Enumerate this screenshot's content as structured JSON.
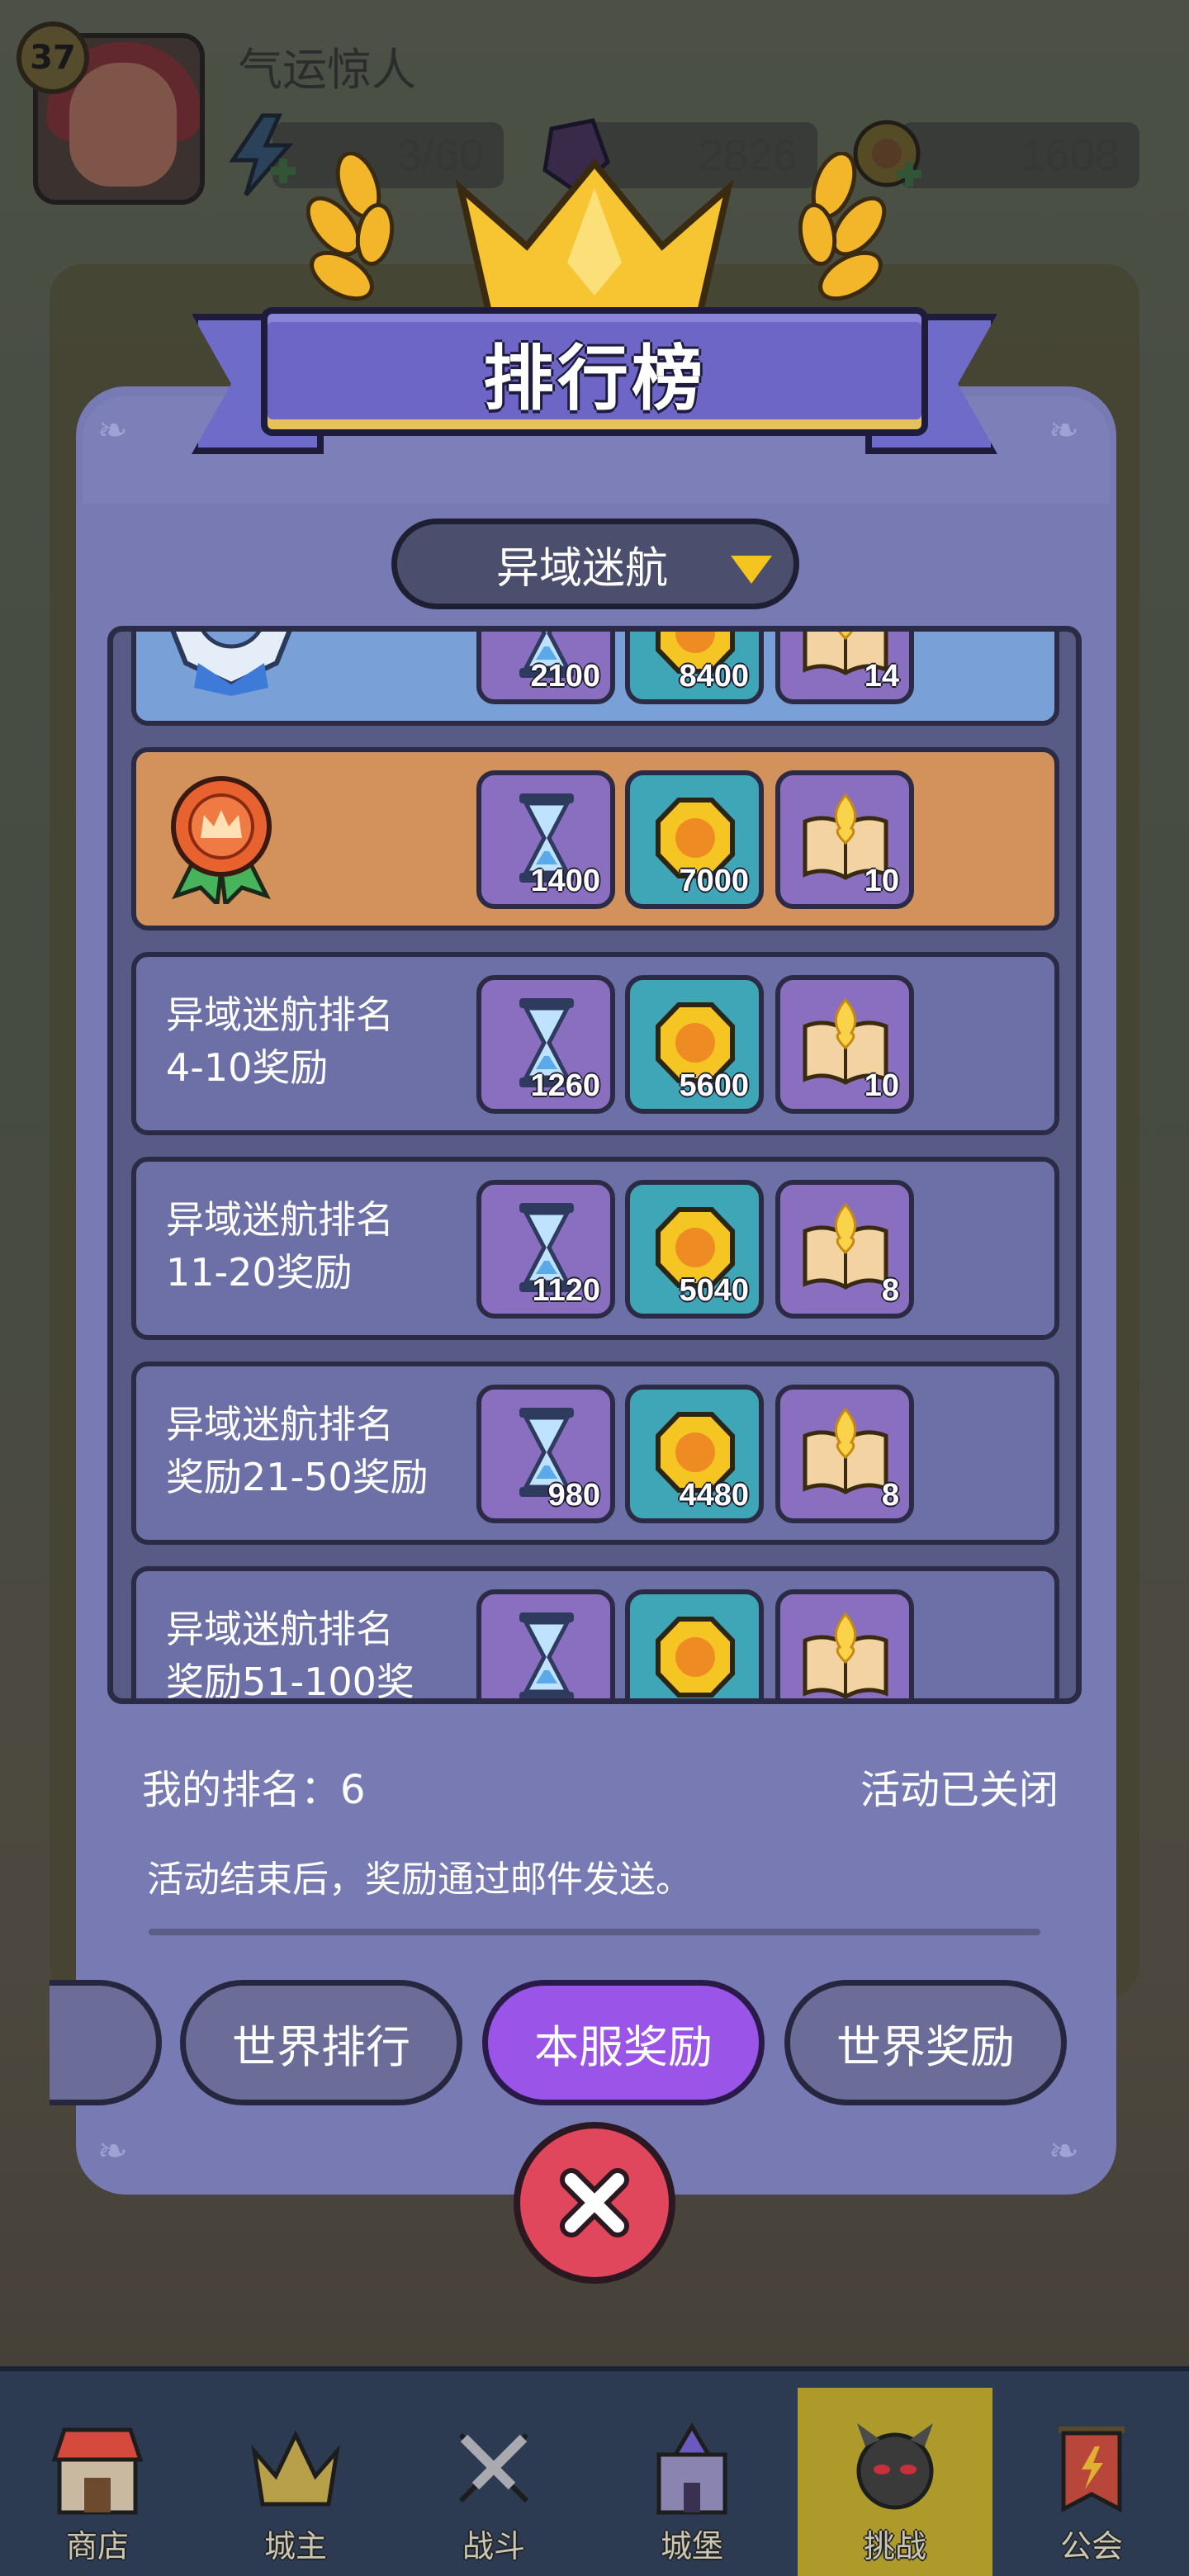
{
  "hud": {
    "level": "37",
    "player_name": "气运惊人",
    "energy": "3/60",
    "gems": "2826",
    "coins": "1608"
  },
  "modal": {
    "title": "排行榜",
    "dropdown_value": "异域迷航",
    "rows": [
      {
        "label": "",
        "tier": "silver",
        "items": [
          {
            "icon": "hourglass-icon",
            "qty": "2100"
          },
          {
            "icon": "gold-coin-icon",
            "qty": "8400"
          },
          {
            "icon": "spellbook-icon",
            "qty": "14"
          }
        ]
      },
      {
        "label": "",
        "tier": "bronze",
        "items": [
          {
            "icon": "hourglass-icon",
            "qty": "1400"
          },
          {
            "icon": "gold-coin-icon",
            "qty": "7000"
          },
          {
            "icon": "spellbook-icon",
            "qty": "10"
          }
        ]
      },
      {
        "label": "异域迷航排名\n4-10奖励",
        "tier": "normal",
        "items": [
          {
            "icon": "hourglass-icon",
            "qty": "1260"
          },
          {
            "icon": "gold-coin-icon",
            "qty": "5600"
          },
          {
            "icon": "spellbook-icon",
            "qty": "10"
          }
        ]
      },
      {
        "label": "异域迷航排名\n11-20奖励",
        "tier": "normal",
        "items": [
          {
            "icon": "hourglass-icon",
            "qty": "1120"
          },
          {
            "icon": "gold-coin-icon",
            "qty": "5040"
          },
          {
            "icon": "spellbook-icon",
            "qty": "8"
          }
        ]
      },
      {
        "label": "异域迷航排名\n奖励21-50奖励",
        "tier": "normal",
        "items": [
          {
            "icon": "hourglass-icon",
            "qty": "980"
          },
          {
            "icon": "gold-coin-icon",
            "qty": "4480"
          },
          {
            "icon": "spellbook-icon",
            "qty": "8"
          }
        ]
      },
      {
        "label": "异域迷航排名\n奖励51-100奖",
        "tier": "normal",
        "items": [
          {
            "icon": "hourglass-icon",
            "qty": ""
          },
          {
            "icon": "gold-coin-icon",
            "qty": ""
          },
          {
            "icon": "spellbook-icon",
            "qty": ""
          }
        ]
      }
    ],
    "my_rank": "我的排名：6",
    "event_status": "活动已关闭",
    "note": "活动结束后，奖励通过邮件发送。",
    "tabs": [
      {
        "label": "世界排行",
        "active": false
      },
      {
        "label": "本服奖励",
        "active": true
      },
      {
        "label": "世界奖励",
        "active": false
      }
    ]
  },
  "bottom_nav": [
    {
      "label": "商店",
      "icon": "shop-icon"
    },
    {
      "label": "城主",
      "icon": "crown-icon"
    },
    {
      "label": "战斗",
      "icon": "crossed-swords-icon"
    },
    {
      "label": "城堡",
      "icon": "castle-icon"
    },
    {
      "label": "挑战",
      "icon": "demon-mask-icon",
      "active": true
    },
    {
      "label": "公会",
      "icon": "guild-banner-icon"
    }
  ],
  "colors": {
    "modal_bg": "#787bb3",
    "silver_row": "#7aa0d8",
    "bronze_row": "#d3925b",
    "active_tab": "#9a55e8",
    "close_button": "#e0465c",
    "nav_active": "#ad9a2a"
  }
}
